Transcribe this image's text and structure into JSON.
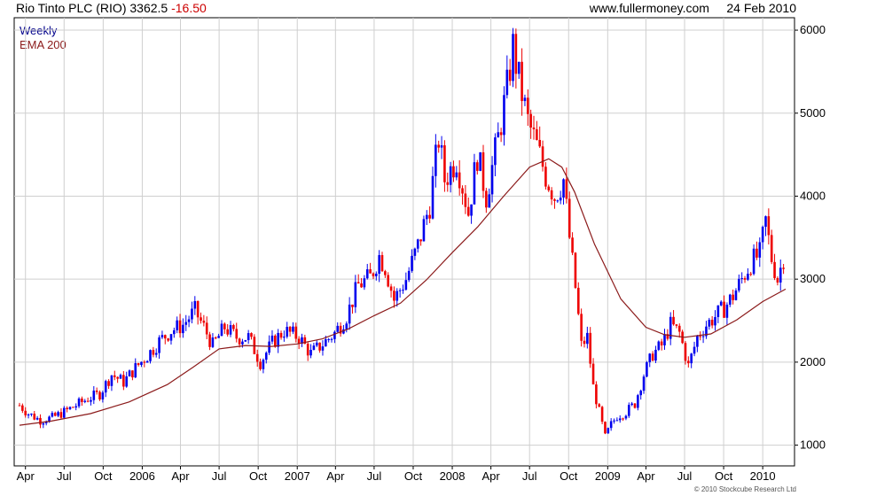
{
  "header": {
    "title": "Rio Tinto PLC (RIO) 3362.5",
    "change": "-16.50",
    "source": "www.fullermoney.com",
    "date": "24 Feb 2010"
  },
  "legend": {
    "weekly": "Weekly",
    "ema": "EMA 200"
  },
  "copyright": "© 2010 Stockcube Research Ltd",
  "colors": {
    "up": "#0000ee",
    "down": "#ee0000",
    "ema": "#8b1a1a",
    "grid": "#cfcfcf",
    "axis": "#000000"
  },
  "chart_data": {
    "type": "line",
    "title": "Rio Tinto PLC (RIO) 3362.5 -16.50",
    "x_range": [
      "2005-03-18",
      "2010-02-24"
    ],
    "ylim": [
      750,
      6150
    ],
    "y_ticks": [
      1000,
      2000,
      3000,
      4000,
      5000,
      6000
    ],
    "x_ticks": [
      {
        "label": "Apr",
        "date": "2005-04-01"
      },
      {
        "label": "Jul",
        "date": "2005-07-01"
      },
      {
        "label": "Oct",
        "date": "2005-10-01"
      },
      {
        "label": "2006",
        "date": "2006-01-01"
      },
      {
        "label": "Apr",
        "date": "2006-04-01"
      },
      {
        "label": "Jul",
        "date": "2006-07-01"
      },
      {
        "label": "Oct",
        "date": "2006-10-01"
      },
      {
        "label": "2007",
        "date": "2007-01-01"
      },
      {
        "label": "Apr",
        "date": "2007-04-01"
      },
      {
        "label": "Jul",
        "date": "2007-07-01"
      },
      {
        "label": "Oct",
        "date": "2007-10-01"
      },
      {
        "label": "2008",
        "date": "2008-01-01"
      },
      {
        "label": "Apr",
        "date": "2008-04-01"
      },
      {
        "label": "Jul",
        "date": "2008-07-01"
      },
      {
        "label": "Oct",
        "date": "2008-10-01"
      },
      {
        "label": "2009",
        "date": "2009-01-01"
      },
      {
        "label": "Apr",
        "date": "2009-04-01"
      },
      {
        "label": "Jul",
        "date": "2009-07-01"
      },
      {
        "label": "Oct",
        "date": "2009-10-01"
      },
      {
        "label": "2010",
        "date": "2010-01-01"
      }
    ],
    "grid": true,
    "series": [
      {
        "name": "Weekly",
        "style": "candlestick",
        "points": [
          [
            "2005-03-18",
            1480
          ],
          [
            "2005-04-08",
            1380
          ],
          [
            "2005-05-06",
            1300
          ],
          [
            "2005-06-03",
            1330
          ],
          [
            "2005-07-01",
            1400
          ],
          [
            "2005-07-29",
            1480
          ],
          [
            "2005-08-26",
            1560
          ],
          [
            "2005-09-23",
            1620
          ],
          [
            "2005-10-21",
            1850
          ],
          [
            "2005-11-18",
            1760
          ],
          [
            "2005-12-16",
            1930
          ],
          [
            "2006-01-13",
            2080
          ],
          [
            "2006-02-10",
            2250
          ],
          [
            "2006-03-10",
            2380
          ],
          [
            "2006-04-07",
            2450
          ],
          [
            "2006-05-05",
            2620
          ],
          [
            "2006-05-26",
            2420
          ],
          [
            "2006-06-16",
            2200
          ],
          [
            "2006-07-14",
            2420
          ],
          [
            "2006-08-11",
            2300
          ],
          [
            "2006-09-08",
            2300
          ],
          [
            "2006-10-06",
            2000
          ],
          [
            "2006-11-03",
            2230
          ],
          [
            "2006-12-01",
            2380
          ],
          [
            "2007-01-05",
            2300
          ],
          [
            "2007-02-02",
            2100
          ],
          [
            "2007-03-02",
            2220
          ],
          [
            "2007-03-30",
            2350
          ],
          [
            "2007-04-27",
            2560
          ],
          [
            "2007-05-25",
            2930
          ],
          [
            "2007-06-22",
            3020
          ],
          [
            "2007-07-13",
            3280
          ],
          [
            "2007-07-27",
            3150
          ],
          [
            "2007-08-17",
            2750
          ],
          [
            "2007-09-14",
            3000
          ],
          [
            "2007-10-12",
            3400
          ],
          [
            "2007-11-09",
            3900
          ],
          [
            "2007-11-30",
            4700
          ],
          [
            "2007-12-14",
            4200
          ],
          [
            "2008-01-11",
            4450
          ],
          [
            "2008-02-08",
            3800
          ],
          [
            "2008-02-29",
            4500
          ],
          [
            "2008-03-21",
            4000
          ],
          [
            "2008-04-18",
            4700
          ],
          [
            "2008-05-09",
            5300
          ],
          [
            "2008-05-23",
            5800
          ],
          [
            "2008-06-06",
            5400
          ],
          [
            "2008-06-27",
            4900
          ],
          [
            "2008-07-18",
            4600
          ],
          [
            "2008-08-08",
            4250
          ],
          [
            "2008-08-29",
            4000
          ],
          [
            "2008-09-19",
            4200
          ],
          [
            "2008-10-03",
            3500
          ],
          [
            "2008-10-17",
            2900
          ],
          [
            "2008-10-31",
            2200
          ],
          [
            "2008-11-14",
            2300
          ],
          [
            "2008-11-28",
            1700
          ],
          [
            "2008-12-12",
            1400
          ],
          [
            "2008-12-26",
            1100
          ],
          [
            "2009-01-09",
            1250
          ],
          [
            "2009-01-23",
            1350
          ],
          [
            "2009-02-13",
            1400
          ],
          [
            "2009-03-06",
            1500
          ],
          [
            "2009-03-27",
            1850
          ],
          [
            "2009-04-17",
            2100
          ],
          [
            "2009-05-08",
            2200
          ],
          [
            "2009-05-29",
            2450
          ],
          [
            "2009-06-19",
            2350
          ],
          [
            "2009-07-10",
            1950
          ],
          [
            "2009-07-31",
            2300
          ],
          [
            "2009-08-21",
            2450
          ],
          [
            "2009-09-11",
            2550
          ],
          [
            "2009-10-02",
            2650
          ],
          [
            "2009-10-23",
            2800
          ],
          [
            "2009-11-13",
            3000
          ],
          [
            "2009-12-04",
            3200
          ],
          [
            "2009-12-25",
            3300
          ],
          [
            "2010-01-08",
            3700
          ],
          [
            "2010-01-22",
            3250
          ],
          [
            "2010-02-05",
            3000
          ],
          [
            "2010-02-24",
            3362.5
          ]
        ]
      },
      {
        "name": "EMA 200",
        "style": "line",
        "points": [
          [
            "2005-03-18",
            1240
          ],
          [
            "2005-06-01",
            1290
          ],
          [
            "2005-09-01",
            1380
          ],
          [
            "2005-12-01",
            1520
          ],
          [
            "2006-03-01",
            1730
          ],
          [
            "2006-05-01",
            1940
          ],
          [
            "2006-07-01",
            2160
          ],
          [
            "2006-09-01",
            2200
          ],
          [
            "2006-11-01",
            2190
          ],
          [
            "2007-01-01",
            2220
          ],
          [
            "2007-03-01",
            2280
          ],
          [
            "2007-05-01",
            2400
          ],
          [
            "2007-07-01",
            2560
          ],
          [
            "2007-09-01",
            2710
          ],
          [
            "2007-11-01",
            2990
          ],
          [
            "2008-01-01",
            3320
          ],
          [
            "2008-03-01",
            3630
          ],
          [
            "2008-05-01",
            4000
          ],
          [
            "2008-07-01",
            4350
          ],
          [
            "2008-08-15",
            4450
          ],
          [
            "2008-09-15",
            4350
          ],
          [
            "2008-10-15",
            4050
          ],
          [
            "2008-12-01",
            3420
          ],
          [
            "2009-02-01",
            2760
          ],
          [
            "2009-04-01",
            2420
          ],
          [
            "2009-05-15",
            2330
          ],
          [
            "2009-07-01",
            2300
          ],
          [
            "2009-09-01",
            2340
          ],
          [
            "2009-11-01",
            2510
          ],
          [
            "2010-01-01",
            2730
          ],
          [
            "2010-02-24",
            2880
          ]
        ]
      }
    ]
  }
}
